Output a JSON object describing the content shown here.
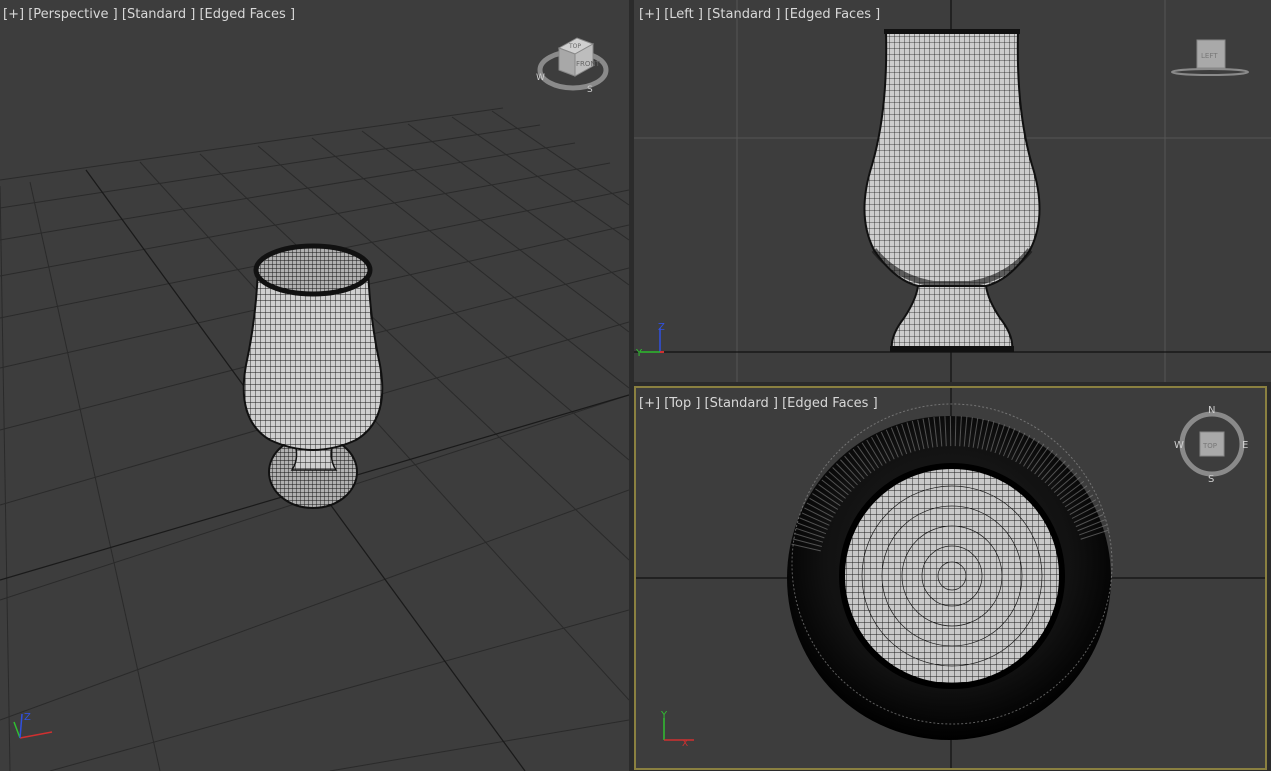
{
  "viewports": {
    "perspective": {
      "menu": "[+]",
      "view": "[Perspective ]",
      "shading": "[Standard ]",
      "mode": "[Edged Faces ]",
      "navcube_labels": {
        "face": "FRONT",
        "top": "TOP",
        "w": "W",
        "s": "S"
      }
    },
    "left": {
      "menu": "[+]",
      "view": "[Left ]",
      "shading": "[Standard ]",
      "mode": "[Edged Faces ]",
      "navcube_labels": {
        "face": "LEFT"
      }
    },
    "top": {
      "menu": "[+]",
      "view": "[Top ]",
      "shading": "[Standard ]",
      "mode": "[Edged Faces ]",
      "active": true,
      "navcube_labels": {
        "face": "TOP",
        "n": "N",
        "s": "S",
        "w": "W",
        "e": "E"
      }
    }
  },
  "axes": {
    "x": "X",
    "y": "Y",
    "z": "Z"
  },
  "colors": {
    "viewport_bg": "#3d3d3d",
    "grid": "#272727",
    "active_border": "#8a8040",
    "mesh_fill": "#c8c8c8",
    "axis_x": "#d03030",
    "axis_y": "#30c030",
    "axis_z": "#3050e0"
  }
}
